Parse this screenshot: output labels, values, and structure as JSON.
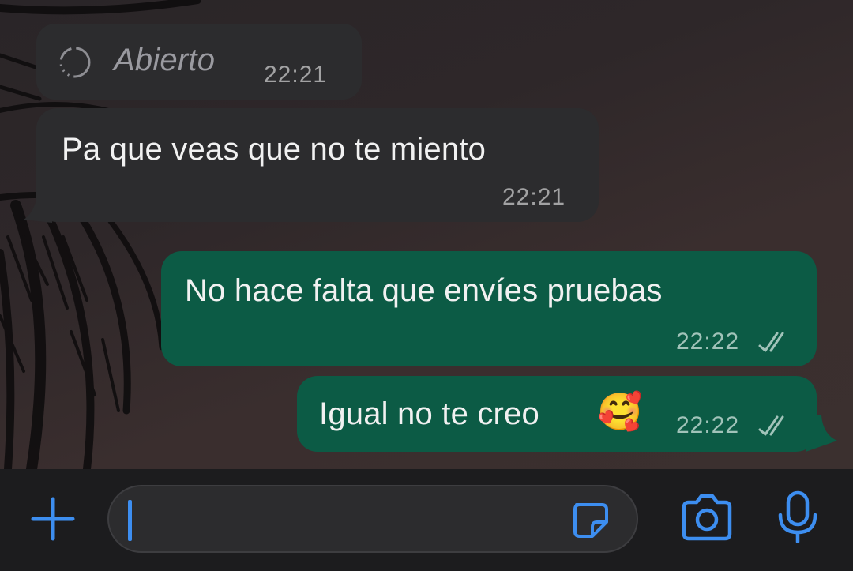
{
  "messages": [
    {
      "type": "status",
      "direction": "in",
      "label": "Abierto",
      "time": "22:21",
      "status_icon": "dashed-circle-icon"
    },
    {
      "type": "text",
      "direction": "in",
      "text": "Pa que veas que no te miento",
      "time": "22:21"
    },
    {
      "type": "text",
      "direction": "out",
      "text": "No hace falta que envíes pruebas",
      "time": "22:22",
      "read_icon": "double-check-icon"
    },
    {
      "type": "text",
      "direction": "out",
      "text": "Igual no te creo",
      "emoji": "🥰",
      "time": "22:22",
      "read_icon": "double-check-icon"
    }
  ],
  "composer": {
    "input_value": "",
    "icons": [
      "plus-icon",
      "sticker-icon",
      "camera-icon",
      "microphone-icon"
    ]
  },
  "colors": {
    "incoming_bubble": "#2c2c2e",
    "outgoing_bubble": "#0c5b45",
    "accent": "#3d8ef0",
    "composer_background": "#1c1c1e"
  }
}
